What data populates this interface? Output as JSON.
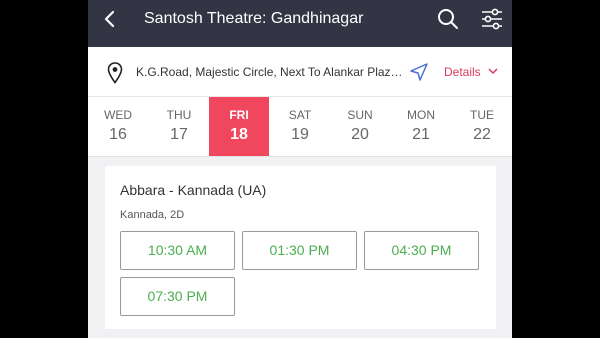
{
  "header": {
    "title": "Santosh Theatre: Gandhinagar",
    "back_icon": "back-arrow-icon",
    "search_icon": "search-icon",
    "filter_icon": "filter-sliders-icon"
  },
  "location": {
    "address": "K.G.Road, Majestic Circle, Next To Alankar Plaza, Bengaluru",
    "details_label": "Details"
  },
  "dates": [
    {
      "weekday": "WED",
      "day": "16",
      "selected": false
    },
    {
      "weekday": "THU",
      "day": "17",
      "selected": false
    },
    {
      "weekday": "FRI",
      "day": "18",
      "selected": true
    },
    {
      "weekday": "SAT",
      "day": "19",
      "selected": false
    },
    {
      "weekday": "SUN",
      "day": "20",
      "selected": false
    },
    {
      "weekday": "MON",
      "day": "21",
      "selected": false
    },
    {
      "weekday": "TUE",
      "day": "22",
      "selected": false
    }
  ],
  "movie": {
    "title": "Abbara - Kannada (UA)",
    "meta": "Kannada, 2D",
    "showtimes": [
      "10:30 AM",
      "01:30 PM",
      "04:30 PM",
      "07:30 PM"
    ]
  },
  "colors": {
    "header_bg": "#333545",
    "accent": "#f0475f",
    "showtime_green": "#4caf50"
  }
}
